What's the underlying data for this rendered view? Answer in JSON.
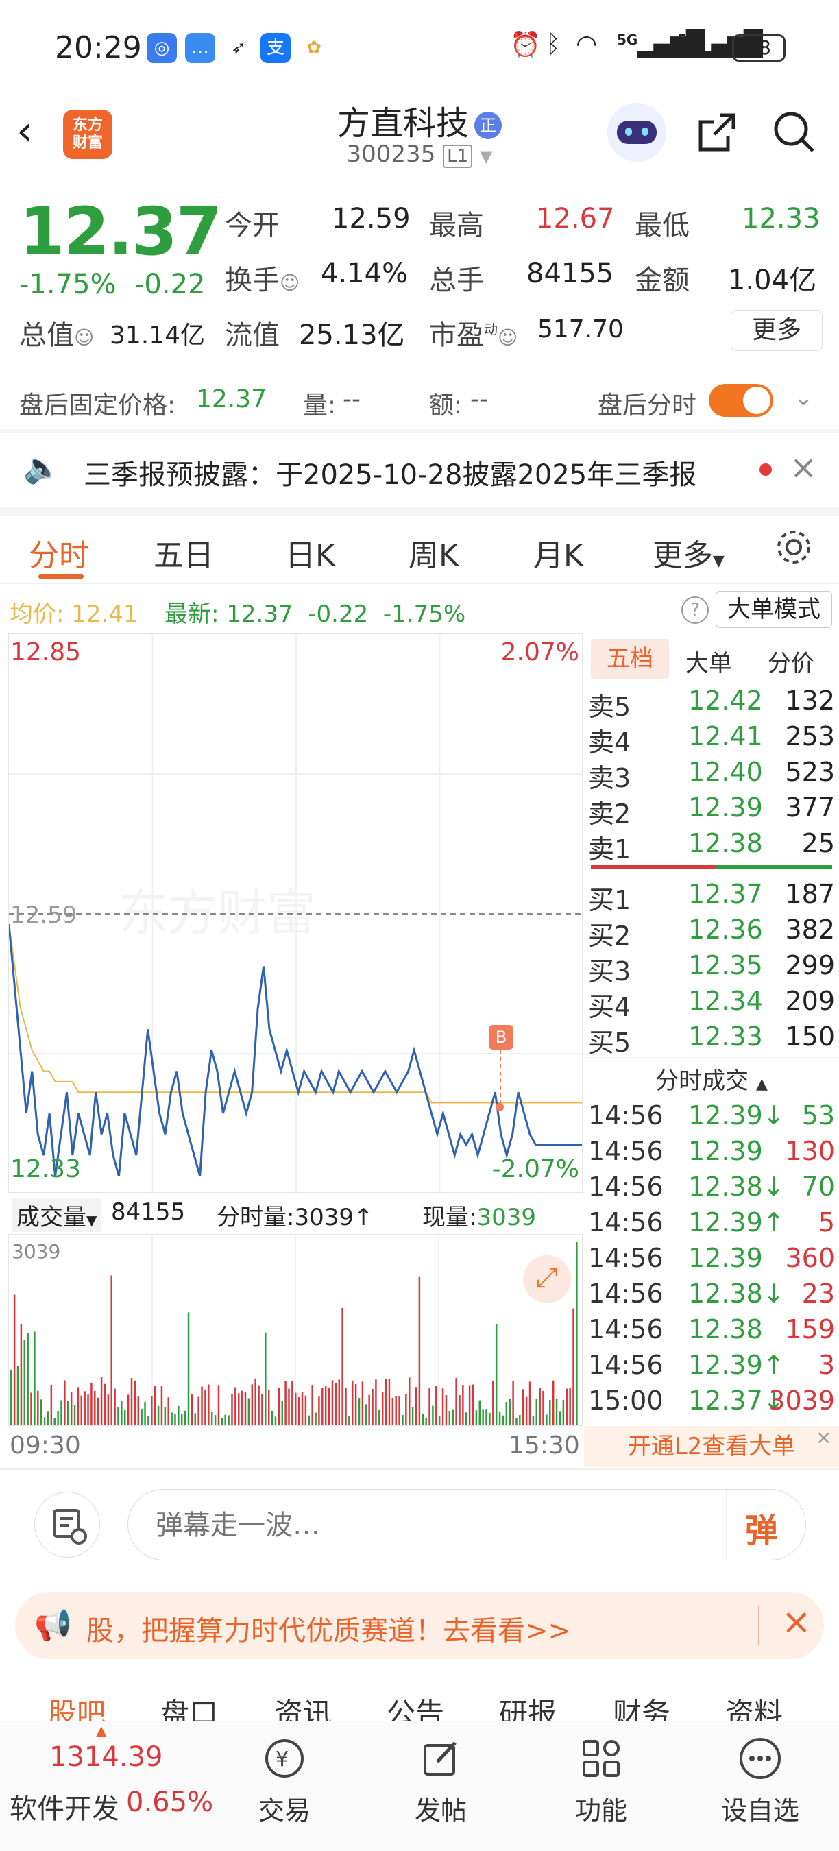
{
  "status_bar": {
    "time": "20:29",
    "battery": "58",
    "net1": "5G",
    "net2": "5G"
  },
  "header": {
    "logo_text": "东方财富",
    "title": "方直科技",
    "title_badge": "正",
    "code": "300235",
    "level": "L1"
  },
  "quote": {
    "price": "12.37",
    "change_pct": "-1.75%",
    "change": "-0.22",
    "open_label": "今开",
    "open": "12.59",
    "high_label": "最高",
    "high": "12.67",
    "low_label": "最低",
    "low": "12.33",
    "turnover_label": "换手",
    "turnover": "4.14%",
    "volume_label": "总手",
    "volume": "84155",
    "amount_label": "金额",
    "amount": "1.04亿",
    "mktcap_label": "总值",
    "mktcap": "31.14亿",
    "float_label": "流值",
    "float": "25.13亿",
    "pe_label": "市盈",
    "pe_sup": "动",
    "pe": "517.70",
    "more": "更多"
  },
  "after_hours": {
    "fixed_label": "盘后固定价格:",
    "fixed_price": "12.37",
    "vol_label": "量:",
    "vol": "--",
    "amt_label": "额:",
    "amt": "--",
    "intraday_label": "盘后分时"
  },
  "notice": {
    "text": "三季报预披露：于2025-10-28披露2025年三季报"
  },
  "chart_tabs": [
    "分时",
    "五日",
    "日K",
    "周K",
    "月K",
    "更多"
  ],
  "chart_info": {
    "avg_label": "均价:",
    "avg": "12.41",
    "latest_label": "最新:",
    "latest": "12.37",
    "chg": "-0.22",
    "chg_pct": "-1.75%",
    "big_order_mode": "大单模式"
  },
  "chart_data": {
    "type": "line",
    "y_max_label": "12.85",
    "y_max_pct": "2.07%",
    "y_ref_label": "12.59",
    "y_min_label": "12.33",
    "y_min_pct": "-2.07%",
    "ylim": [
      12.33,
      12.85
    ],
    "prev_close": 12.59,
    "price_series": [
      12.58,
      12.52,
      12.46,
      12.4,
      12.44,
      12.38,
      12.36,
      12.4,
      12.34,
      12.38,
      12.42,
      12.36,
      12.4,
      12.38,
      12.36,
      12.42,
      12.38,
      12.4,
      12.36,
      12.34,
      12.4,
      12.38,
      12.36,
      12.42,
      12.48,
      12.44,
      12.4,
      12.38,
      12.42,
      12.44,
      12.4,
      12.38,
      12.36,
      12.34,
      12.42,
      12.46,
      12.44,
      12.4,
      12.42,
      12.44,
      12.42,
      12.4,
      12.42,
      12.5,
      12.54,
      12.48,
      12.46,
      12.44,
      12.46,
      12.44,
      12.42,
      12.44,
      12.43,
      12.42,
      12.44,
      12.43,
      12.42,
      12.44,
      12.43,
      12.42,
      12.43,
      12.44,
      12.43,
      12.42,
      12.43,
      12.44,
      12.43,
      12.42,
      12.43,
      12.44,
      12.46,
      12.44,
      12.42,
      12.4,
      12.38,
      12.4,
      12.38,
      12.36,
      12.38,
      12.37,
      12.38,
      12.36,
      12.38,
      12.4,
      12.42,
      12.38,
      12.36,
      12.38,
      12.42,
      12.4,
      12.38,
      12.37,
      12.37,
      12.37,
      12.37,
      12.37,
      12.37,
      12.37,
      12.37,
      12.37
    ],
    "avg_series": [
      12.58,
      12.54,
      12.5,
      12.48,
      12.46,
      12.45,
      12.44,
      12.44,
      12.43,
      12.43,
      12.43,
      12.43,
      12.42,
      12.42,
      12.42,
      12.42,
      12.42,
      12.42,
      12.42,
      12.42,
      12.42,
      12.42,
      12.42,
      12.42,
      12.42,
      12.42,
      12.42,
      12.42,
      12.42,
      12.42,
      12.42,
      12.42,
      12.42,
      12.42,
      12.42,
      12.42,
      12.42,
      12.42,
      12.42,
      12.42,
      12.42,
      12.42,
      12.42,
      12.42,
      12.42,
      12.42,
      12.42,
      12.42,
      12.42,
      12.42,
      12.42,
      12.42,
      12.42,
      12.42,
      12.42,
      12.42,
      12.42,
      12.42,
      12.42,
      12.42,
      12.42,
      12.42,
      12.42,
      12.42,
      12.42,
      12.42,
      12.42,
      12.42,
      12.42,
      12.42,
      12.42,
      12.42,
      12.42,
      12.41,
      12.41,
      12.41,
      12.41,
      12.41,
      12.41,
      12.41,
      12.41,
      12.41,
      12.41,
      12.41,
      12.41,
      12.41,
      12.41,
      12.41,
      12.41,
      12.41,
      12.41,
      12.41,
      12.41,
      12.41,
      12.41,
      12.41,
      12.41,
      12.41,
      12.41,
      12.41
    ],
    "volume_label": "成交量",
    "volume": "84155",
    "min_vol_label": "分时量:3039↑",
    "cur_vol_label": "现量:",
    "cur_vol": "3039",
    "vol_axis_max": "3039",
    "time_start": "09:30",
    "time_end": "15:30",
    "trade_marker": "B"
  },
  "order_book": {
    "tabs": [
      "五档",
      "大单",
      "分价"
    ],
    "asks": [
      {
        "label": "卖5",
        "price": "12.42",
        "vol": "132"
      },
      {
        "label": "卖4",
        "price": "12.41",
        "vol": "253"
      },
      {
        "label": "卖3",
        "price": "12.40",
        "vol": "523"
      },
      {
        "label": "卖2",
        "price": "12.39",
        "vol": "377"
      },
      {
        "label": "卖1",
        "price": "12.38",
        "vol": "25"
      }
    ],
    "bids": [
      {
        "label": "买1",
        "price": "12.37",
        "vol": "187"
      },
      {
        "label": "买2",
        "price": "12.36",
        "vol": "382"
      },
      {
        "label": "买3",
        "price": "12.35",
        "vol": "299"
      },
      {
        "label": "买4",
        "price": "12.34",
        "vol": "209"
      },
      {
        "label": "买5",
        "price": "12.33",
        "vol": "150"
      }
    ],
    "ticks_title": "分时成交",
    "ticks": [
      {
        "time": "14:56",
        "price": "12.39↓",
        "vol": "53"
      },
      {
        "time": "14:56",
        "price": "12.39",
        "vol": "130"
      },
      {
        "time": "14:56",
        "price": "12.38↓",
        "vol": "70"
      },
      {
        "time": "14:56",
        "price": "12.39↑",
        "vol": "5"
      },
      {
        "time": "14:56",
        "price": "12.39",
        "vol": "360"
      },
      {
        "time": "14:56",
        "price": "12.38↓",
        "vol": "23"
      },
      {
        "time": "14:56",
        "price": "12.38",
        "vol": "159"
      },
      {
        "time": "14:56",
        "price": "12.39↑",
        "vol": "3"
      },
      {
        "time": "15:00",
        "price": "12.37↓",
        "vol": "3039"
      }
    ],
    "l2_banner": "开通L2查看大单"
  },
  "danmu": {
    "placeholder": "弹幕走一波…",
    "send": "弹"
  },
  "promo": {
    "text": "股，把握算力时代优质赛道！去看看>>"
  },
  "nav_tabs": [
    "股吧",
    "盘口",
    "资讯",
    "公告",
    "研报",
    "财务",
    "资料"
  ],
  "bottom": {
    "index_value": "1314.39",
    "index_name": "软件开发",
    "index_chg": "0.65%",
    "buttons": [
      "交易",
      "发帖",
      "功能",
      "设自选"
    ]
  },
  "colors": {
    "accent": "#e8642a",
    "up": "#d8383b",
    "down": "#2e9e3e",
    "avg": "#e8b94a",
    "line": "#2f62b0"
  }
}
